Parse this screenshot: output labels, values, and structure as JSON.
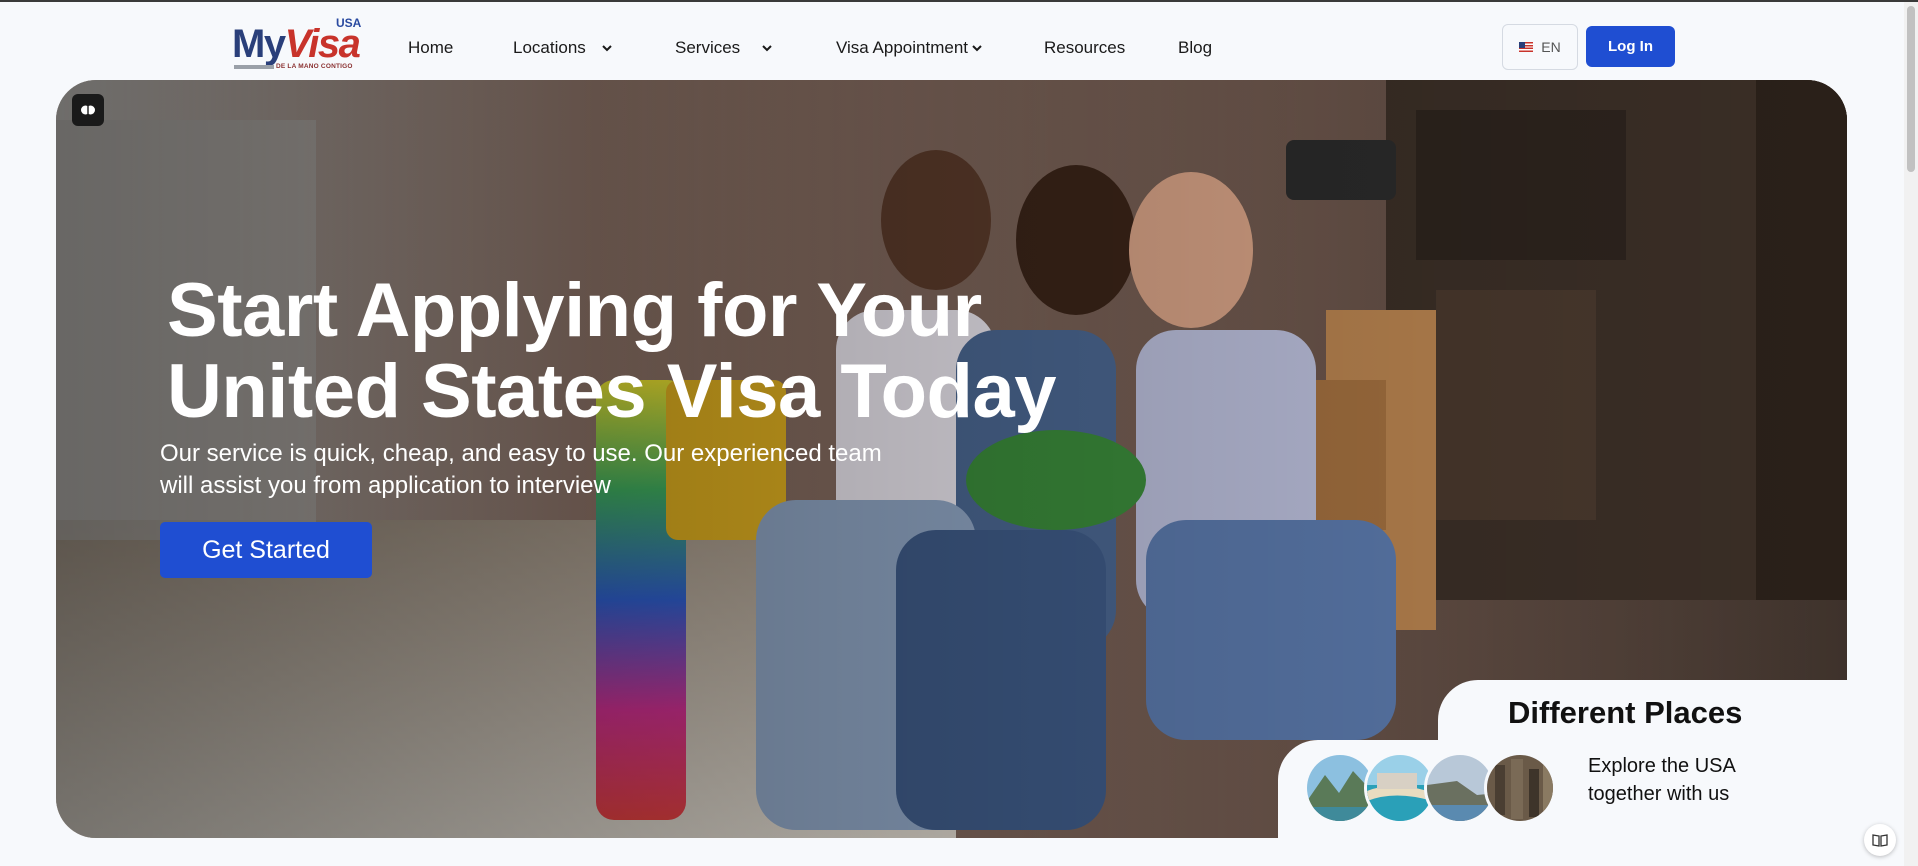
{
  "brand": {
    "logo_my": "My",
    "logo_visa": "Visa",
    "logo_usa": "USA",
    "logo_tagline": "DE LA MANO CONTIGO",
    "colors": {
      "primary": "#1f4ed2",
      "logo_blue": "#2a3f7a",
      "logo_red": "#c8332b"
    }
  },
  "nav": {
    "items": [
      {
        "label": "Home",
        "dropdown": false
      },
      {
        "label": "Locations",
        "dropdown": true
      },
      {
        "label": "Services",
        "dropdown": true
      },
      {
        "label": "Visa Appointment",
        "dropdown": true
      },
      {
        "label": "Resources",
        "dropdown": false
      },
      {
        "label": "Blog",
        "dropdown": false
      }
    ],
    "language": "EN",
    "language_icon": "us-flag-icon",
    "login_label": "Log In"
  },
  "hero": {
    "title_line1": "Start Applying for Your",
    "title_line2": "United States Visa Today",
    "subtitle_line1": "Our service is quick, cheap, and easy to use. Our experienced team",
    "subtitle_line2": "will assist you from application to interview",
    "cta_label": "Get Started"
  },
  "places": {
    "title": "Different Places",
    "text_line1": "Explore the USA",
    "text_line2": "together with us",
    "thumbnails": [
      "mountain-lake-icon",
      "beach-coast-icon",
      "cliff-coast-icon",
      "city-aerial-icon"
    ]
  }
}
